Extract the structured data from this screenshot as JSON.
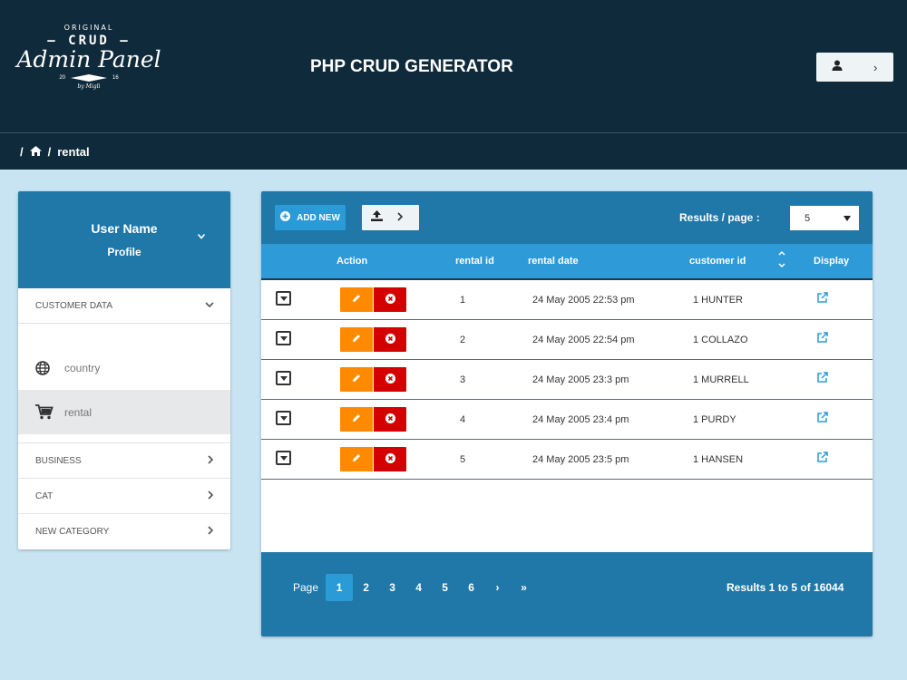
{
  "logo": {
    "line1": "ORIGINAL",
    "line2": "— CRUD —",
    "line3": "Admin Panel",
    "year_left": "20",
    "year_right": "16",
    "byline": "by Migli"
  },
  "header": {
    "title": "PHP CRUD GENERATOR",
    "user_button_icon": "user-icon",
    "user_button_chevron": "›"
  },
  "breadcrumb": {
    "sep": "/",
    "home_icon": "home-icon",
    "current": "rental"
  },
  "sidebar": {
    "user_name": "User Name",
    "profile": "Profile",
    "categories": [
      {
        "label": "CUSTOMER DATA",
        "expanded": true
      },
      {
        "label": "BUSINESS",
        "expanded": false
      },
      {
        "label": "CAT",
        "expanded": false
      },
      {
        "label": "NEW CATEGORY",
        "expanded": false
      }
    ],
    "items": [
      {
        "label": "country",
        "icon": "globe-icon",
        "active": false
      },
      {
        "label": "rental",
        "icon": "cart-icon",
        "active": true
      }
    ]
  },
  "toolbar": {
    "add_label": "ADD NEW",
    "export_icon": "upload-icon",
    "results_per_page_label": "Results / page :",
    "results_per_page_value": "5"
  },
  "table": {
    "headers": {
      "action": "Action",
      "rental_id": "rental id",
      "rental_date": "rental date",
      "customer_id": "customer id",
      "display": "Display"
    },
    "rows": [
      {
        "id": "1",
        "date": "24 May 2005 22:53 pm",
        "customer": "1 HUNTER"
      },
      {
        "id": "2",
        "date": "24 May 2005 22:54 pm",
        "customer": "1 COLLAZO"
      },
      {
        "id": "3",
        "date": "24 May 2005 23:3 pm",
        "customer": "1 MURRELL"
      },
      {
        "id": "4",
        "date": "24 May 2005 23:4 pm",
        "customer": "1 PURDY"
      },
      {
        "id": "5",
        "date": "24 May 2005 23:5 pm",
        "customer": "1 HANSEN"
      }
    ]
  },
  "pagination": {
    "label": "Page",
    "pages": [
      "1",
      "2",
      "3",
      "4",
      "5",
      "6"
    ],
    "current": "1",
    "next": "›",
    "last": "»",
    "results_text": "Results 1 to 5 of 16044"
  },
  "colors": {
    "header_bg": "#0f2a3a",
    "primary": "#1f78a8",
    "accent": "#2a9bd6",
    "edit": "#ff8a00",
    "delete": "#d40000",
    "page_bg": "#c8e4f3"
  }
}
